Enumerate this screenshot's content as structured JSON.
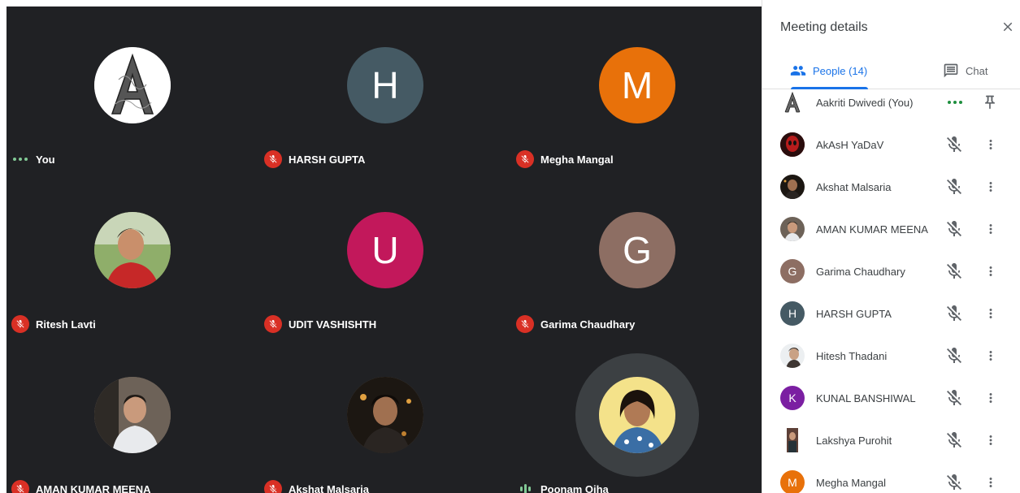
{
  "grid": {
    "tiles": [
      {
        "name": "You",
        "avatar_type": "logo-A",
        "status": "speaking-dots"
      },
      {
        "name": "HARSH GUPTA",
        "avatar_letter": "H",
        "avatar_color": "#455a64",
        "status": "muted"
      },
      {
        "name": "Megha Mangal",
        "avatar_letter": "M",
        "avatar_color": "#e8710a",
        "status": "muted"
      },
      {
        "name": "Ritesh Lavti",
        "avatar_type": "photo",
        "status": "muted"
      },
      {
        "name": "UDIT VASHISHTH",
        "avatar_letter": "U",
        "avatar_color": "#c2185b",
        "status": "muted"
      },
      {
        "name": "Garima Chaudhary",
        "avatar_letter": "G",
        "avatar_color": "#8d6e63",
        "status": "muted"
      },
      {
        "name": "AMAN KUMAR MEENA",
        "avatar_type": "photo",
        "status": "muted"
      },
      {
        "name": "Akshat Malsaria",
        "avatar_type": "photo",
        "status": "muted"
      },
      {
        "name": "Poonam Ojha",
        "avatar_type": "photo",
        "status": "speaking-audio"
      }
    ]
  },
  "panel": {
    "title": "Meeting details",
    "tabs": {
      "people_label": "People (14)",
      "chat_label": "Chat"
    },
    "people": [
      {
        "name": "Aakriti Dwivedi (You)",
        "avatar": "logo-A",
        "control": "dots-pin"
      },
      {
        "name": "AkAsH YaDaV",
        "avatar": "photo",
        "avatar_color": "#6a1b1b",
        "control": "muted"
      },
      {
        "name": "Akshat Malsaria",
        "avatar": "photo",
        "avatar_color": "#3e2723",
        "control": "muted"
      },
      {
        "name": "AMAN KUMAR MEENA",
        "avatar": "photo",
        "avatar_color": "#795548",
        "control": "muted"
      },
      {
        "name": "Garima Chaudhary",
        "avatar": "letter",
        "letter": "G",
        "avatar_color": "#8d6e63",
        "control": "muted"
      },
      {
        "name": "HARSH GUPTA",
        "avatar": "letter",
        "letter": "H",
        "avatar_color": "#455a64",
        "control": "muted"
      },
      {
        "name": "Hitesh Thadani",
        "avatar": "photo",
        "avatar_color": "#bcaaa4",
        "control": "muted"
      },
      {
        "name": "KUNAL BANSHIWAL",
        "avatar": "letter",
        "letter": "K",
        "avatar_color": "#7b1fa2",
        "control": "muted"
      },
      {
        "name": "Lakshya Purohit",
        "avatar": "photo",
        "avatar_color": "#6d4c41",
        "control": "muted"
      },
      {
        "name": "Megha Mangal",
        "avatar": "letter",
        "letter": "M",
        "avatar_color": "#e8710a",
        "control": "muted"
      }
    ]
  },
  "colors": {
    "grid_background": "#202124",
    "muted_red": "#d93025",
    "accent_blue": "#1a73e8",
    "speaking_green": "#81c995"
  }
}
